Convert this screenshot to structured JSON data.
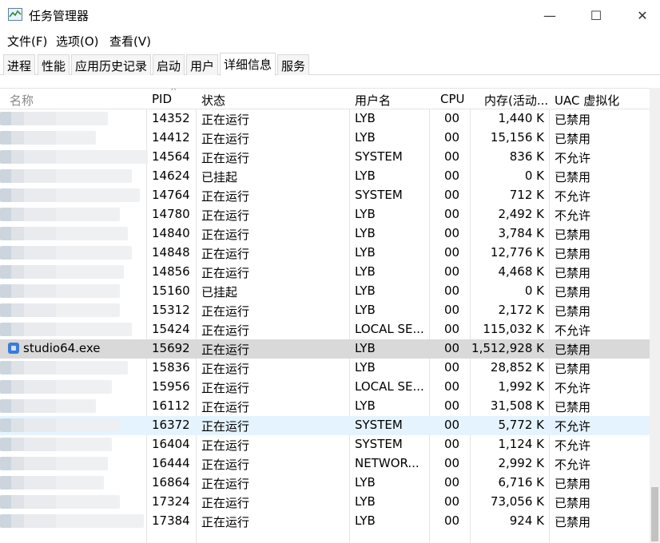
{
  "window": {
    "title": "任务管理器",
    "minimize": "—",
    "maximize": "☐",
    "close": "✕"
  },
  "menu": [
    "文件(F)",
    "选项(O)",
    "查看(V)"
  ],
  "tabs": [
    "进程",
    "性能",
    "应用历史记录",
    "启动",
    "用户",
    "详细信息",
    "服务"
  ],
  "active_tab": "详细信息",
  "columns": {
    "name": "名称",
    "pid": "PID",
    "status": "状态",
    "user": "用户名",
    "cpu": "CPU",
    "memory": "内存(活动...",
    "uac": "UAC 虚拟化"
  },
  "rows": [
    {
      "name": "",
      "pid": "14352",
      "status": "正在运行",
      "user": "LYB",
      "cpu": "00",
      "mem": "1,440 K",
      "uac": "已禁用"
    },
    {
      "name": "",
      "pid": "14412",
      "status": "正在运行",
      "user": "LYB",
      "cpu": "00",
      "mem": "15,156 K",
      "uac": "已禁用"
    },
    {
      "name": "",
      "pid": "14564",
      "status": "正在运行",
      "user": "SYSTEM",
      "cpu": "00",
      "mem": "836 K",
      "uac": "不允许"
    },
    {
      "name": "",
      "pid": "14624",
      "status": "已挂起",
      "user": "LYB",
      "cpu": "00",
      "mem": "0 K",
      "uac": "已禁用"
    },
    {
      "name": "",
      "pid": "14764",
      "status": "正在运行",
      "user": "SYSTEM",
      "cpu": "00",
      "mem": "712 K",
      "uac": "不允许"
    },
    {
      "name": "",
      "pid": "14780",
      "status": "正在运行",
      "user": "LYB",
      "cpu": "00",
      "mem": "2,492 K",
      "uac": "不允许"
    },
    {
      "name": "",
      "pid": "14840",
      "status": "正在运行",
      "user": "LYB",
      "cpu": "00",
      "mem": "3,784 K",
      "uac": "已禁用"
    },
    {
      "name": "",
      "pid": "14848",
      "status": "正在运行",
      "user": "LYB",
      "cpu": "00",
      "mem": "12,776 K",
      "uac": "已禁用"
    },
    {
      "name": "",
      "pid": "14856",
      "status": "正在运行",
      "user": "LYB",
      "cpu": "00",
      "mem": "4,468 K",
      "uac": "已禁用"
    },
    {
      "name": "",
      "pid": "15160",
      "status": "已挂起",
      "user": "LYB",
      "cpu": "00",
      "mem": "0 K",
      "uac": "已禁用"
    },
    {
      "name": "",
      "pid": "15312",
      "status": "正在运行",
      "user": "LYB",
      "cpu": "00",
      "mem": "2,172 K",
      "uac": "已禁用"
    },
    {
      "name": "",
      "pid": "15424",
      "status": "正在运行",
      "user": "LOCAL SE...",
      "cpu": "00",
      "mem": "115,032 K",
      "uac": "不允许"
    },
    {
      "name": "studio64.exe",
      "pid": "15692",
      "status": "正在运行",
      "user": "LYB",
      "cpu": "00",
      "mem": "1,512,928 K",
      "uac": "已禁用",
      "selected": true
    },
    {
      "name": "",
      "pid": "15836",
      "status": "正在运行",
      "user": "LYB",
      "cpu": "00",
      "mem": "28,852 K",
      "uac": "已禁用"
    },
    {
      "name": "",
      "pid": "15956",
      "status": "正在运行",
      "user": "LOCAL SE...",
      "cpu": "00",
      "mem": "1,992 K",
      "uac": "不允许"
    },
    {
      "name": "",
      "pid": "16112",
      "status": "正在运行",
      "user": "LYB",
      "cpu": "00",
      "mem": "31,508 K",
      "uac": "已禁用"
    },
    {
      "name": "",
      "pid": "16372",
      "status": "正在运行",
      "user": "SYSTEM",
      "cpu": "00",
      "mem": "5,772 K",
      "uac": "不允许",
      "hover": true
    },
    {
      "name": "",
      "pid": "16404",
      "status": "正在运行",
      "user": "SYSTEM",
      "cpu": "00",
      "mem": "1,124 K",
      "uac": "不允许"
    },
    {
      "name": "",
      "pid": "16444",
      "status": "正在运行",
      "user": "NETWOR...",
      "cpu": "00",
      "mem": "2,992 K",
      "uac": "不允许"
    },
    {
      "name": "",
      "pid": "16864",
      "status": "正在运行",
      "user": "LYB",
      "cpu": "00",
      "mem": "6,716 K",
      "uac": "已禁用"
    },
    {
      "name": "",
      "pid": "17324",
      "status": "正在运行",
      "user": "LYB",
      "cpu": "00",
      "mem": "73,056 K",
      "uac": "已禁用"
    },
    {
      "name": "",
      "pid": "17384",
      "status": "正在运行",
      "user": "LYB",
      "cpu": "00",
      "mem": "924 K",
      "uac": "已禁用"
    }
  ]
}
